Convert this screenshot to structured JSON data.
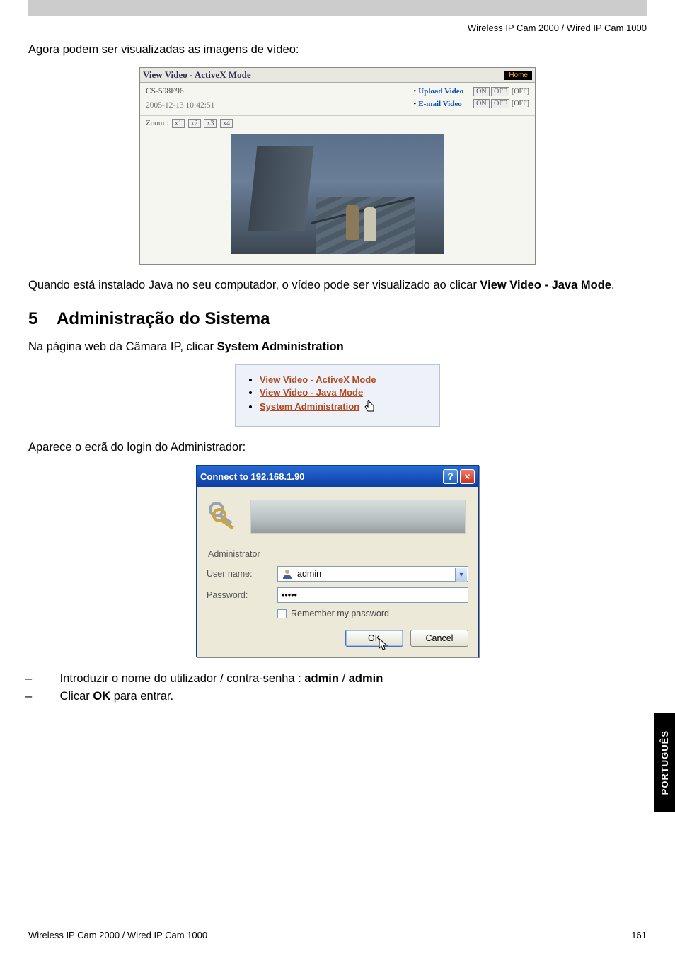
{
  "header": {
    "product_line": "Wireless IP Cam 2000 / Wired IP Cam 1000"
  },
  "intro1": "Agora podem ser visualizadas as imagens de vídeo:",
  "fig1": {
    "title": "View Video - ActiveX Mode",
    "home": "Home",
    "device_id": "CS-598E96",
    "timestamp": "2005-12-13 10:42:51",
    "upload_label": "Upload Video",
    "email_label": "E-mail Video",
    "on": "ON",
    "off": "OFF",
    "off_status": "[OFF]",
    "zoom_label": "Zoom :",
    "zoom_levels": [
      "x1",
      "x2",
      "x3",
      "x4"
    ]
  },
  "para2_pre": "Quando está instalado Java no seu computador, o vídeo pode ser visualizado ao clicar ",
  "para2_bold": "View Video - Java Mode",
  "para2_post": ".",
  "section": {
    "num": "5",
    "title": "Administração do Sistema"
  },
  "para3_pre": "Na página web da Câmara IP, clicar ",
  "para3_bold": "System Administration",
  "fig2": {
    "link1": "View Video - ActiveX Mode",
    "link2": "View Video - Java Mode",
    "link3": "System Administration"
  },
  "para4": "Aparece o ecrã do login do Administrador:",
  "fig3": {
    "title": "Connect to 192.168.1.90",
    "realm": "Administrator",
    "user_label": "User name:",
    "user_value": "admin",
    "pass_label": "Password:",
    "pass_value": "•••••",
    "remember": "Remember my password",
    "ok": "OK",
    "cancel": "Cancel"
  },
  "bullets": {
    "b1_pre": "Introduzir o nome do utilizador / contra-senha : ",
    "b1_bold1": "admin",
    "b1_sep": " / ",
    "b1_bold2": "admin",
    "b2_pre": "Clicar ",
    "b2_bold": "OK",
    "b2_post": " para entrar."
  },
  "sidetab": "PORTUGUÊS",
  "footer": {
    "left": "Wireless IP Cam 2000 / Wired IP Cam 1000",
    "page": "161"
  }
}
